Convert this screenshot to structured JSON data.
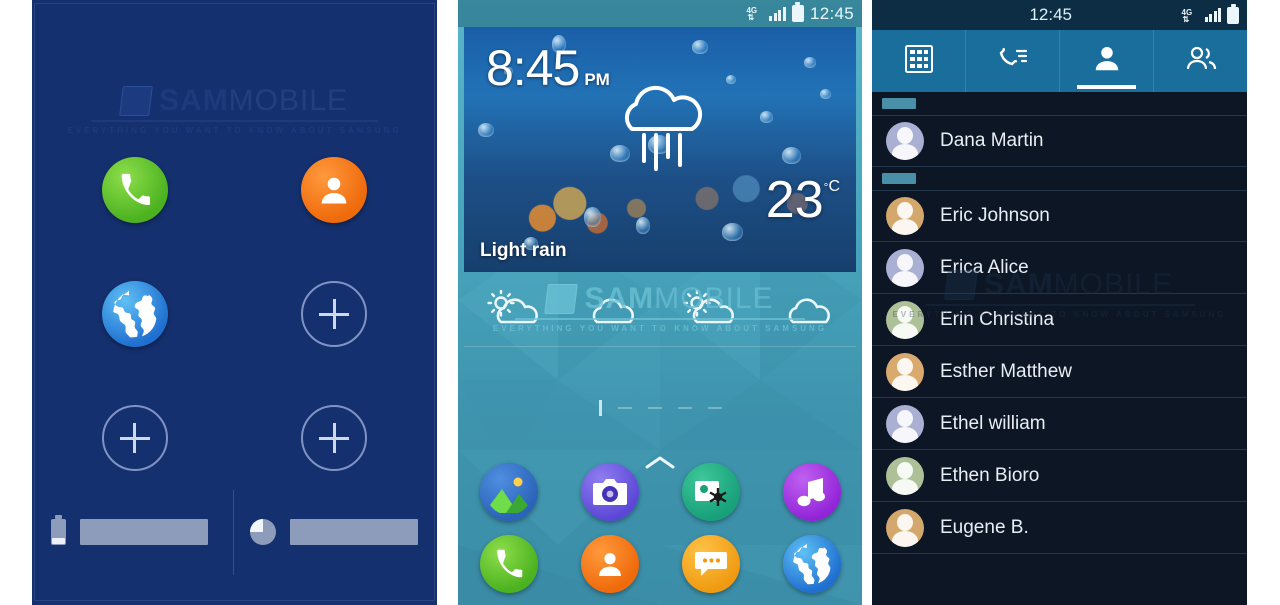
{
  "watermark": {
    "badge": "",
    "sam": "SAM",
    "mobile": "MOBILE",
    "tagline": "EVERYTHING YOU WANT TO KNOW ABOUT SAMSUNG"
  },
  "panel1": {
    "name": "quick-launch-screen",
    "background_color": "#15306e",
    "shortcuts": [
      {
        "id": "phone",
        "icon": "phone-icon",
        "color": "#4cb220",
        "type": "app"
      },
      {
        "id": "contacts",
        "icon": "contacts-icon",
        "color": "#ef6a0b",
        "type": "app"
      },
      {
        "id": "browser",
        "icon": "globe-icon",
        "color": "#1f6fd0",
        "type": "app"
      },
      {
        "id": "add1",
        "icon": "plus-icon",
        "color": "#7f93c4",
        "type": "add"
      },
      {
        "id": "add2",
        "icon": "plus-icon",
        "color": "#7f93c4",
        "type": "add"
      },
      {
        "id": "add3",
        "icon": "plus-icon",
        "color": "#7f93c4",
        "type": "add"
      }
    ],
    "status": {
      "battery_icon": "battery-icon",
      "battery_value": "",
      "storage_icon": "pie-chart-icon",
      "storage_value": ""
    }
  },
  "panel2": {
    "name": "home-screen",
    "statusbar": {
      "network": "4G",
      "signal_bars": 4,
      "battery_icon": "battery-icon",
      "time": "12:45"
    },
    "clock": {
      "time": "8:45",
      "period": "PM"
    },
    "weather": {
      "icon": "rain-cloud-icon",
      "temperature": "23",
      "degree_symbol": "°",
      "unit": "C",
      "condition": "Light rain"
    },
    "forecast": [
      {
        "icon": "sun-cloud-icon"
      },
      {
        "icon": "cloud-icon"
      },
      {
        "icon": "sun-cloud-icon"
      },
      {
        "icon": "cloud-icon"
      }
    ],
    "page_indicator": {
      "active_index": 0,
      "count": 5
    },
    "app_drawer_arrow": "chevron-up-icon",
    "dock": [
      {
        "id": "gallery",
        "icon": "gallery-icon",
        "color": "#2a63b8"
      },
      {
        "id": "camera",
        "icon": "camera-icon",
        "color": "#5b47d6"
      },
      {
        "id": "editor",
        "icon": "photo-editor-icon",
        "color": "#17a079"
      },
      {
        "id": "music",
        "icon": "music-note-icon",
        "color": "#9224d8"
      },
      {
        "id": "phone",
        "icon": "phone-icon",
        "color": "#4cb220"
      },
      {
        "id": "contacts",
        "icon": "contacts-icon",
        "color": "#ef6a0b"
      },
      {
        "id": "messages",
        "icon": "message-icon",
        "color": "#ef9a10"
      },
      {
        "id": "browser",
        "icon": "globe-icon",
        "color": "#2a63b8"
      }
    ]
  },
  "panel3": {
    "name": "contacts-app",
    "statusbar": {
      "time": "12:45",
      "network": "4G",
      "signal_bars": 4,
      "battery_icon": "battery-icon"
    },
    "tabs": [
      {
        "id": "keypad",
        "icon": "keypad-icon",
        "active": false
      },
      {
        "id": "logs",
        "icon": "call-log-icon",
        "active": false
      },
      {
        "id": "contacts",
        "icon": "person-icon",
        "active": true
      },
      {
        "id": "groups",
        "icon": "groups-icon",
        "active": false
      }
    ],
    "contacts": [
      {
        "name": "Dana Martin",
        "avatar_color": "#a9b0d4"
      },
      {
        "name": "Eric Johnson",
        "avatar_color": "#d4a86c"
      },
      {
        "name": "Erica Alice",
        "avatar_color": "#a9b0d4"
      },
      {
        "name": "Erin Christina",
        "avatar_color": "#aec097"
      },
      {
        "name": "Esther Matthew",
        "avatar_color": "#d9a96e"
      },
      {
        "name": "Ethel william",
        "avatar_color": "#a9b0d4"
      },
      {
        "name": "Ethen Bioro",
        "avatar_color": "#aec097"
      },
      {
        "name": "Eugene B.",
        "avatar_color": "#d4a86c"
      }
    ]
  }
}
